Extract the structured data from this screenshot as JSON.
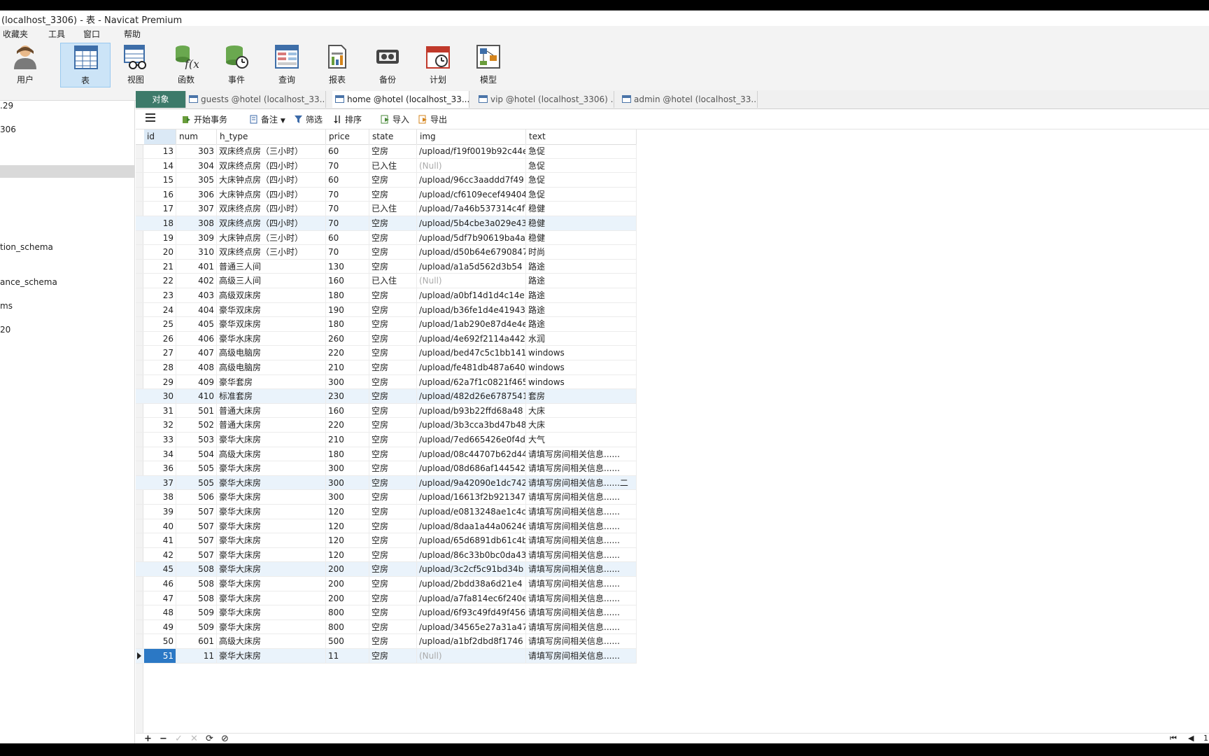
{
  "window_title": "(localhost_3306) - 表 - Navicat Premium",
  "menu": [
    "收藏夹",
    "工具",
    "窗口",
    "帮助"
  ],
  "toolbar": [
    {
      "label": "用户",
      "icon": "user-icon"
    },
    {
      "label": "表",
      "icon": "table-icon",
      "active": true
    },
    {
      "label": "视图",
      "icon": "view-icon"
    },
    {
      "label": "函数",
      "icon": "function-icon"
    },
    {
      "label": "事件",
      "icon": "event-icon"
    },
    {
      "label": "查询",
      "icon": "query-icon"
    },
    {
      "label": "报表",
      "icon": "report-icon"
    },
    {
      "label": "备份",
      "icon": "backup-icon"
    },
    {
      "label": "计划",
      "icon": "schedule-icon"
    },
    {
      "label": "模型",
      "icon": "model-icon"
    }
  ],
  "sidebar": [
    ".29",
    "306",
    "",
    "tion_schema",
    "ance_schema",
    "ms",
    "20"
  ],
  "tabs": [
    {
      "label": "对象",
      "type": "objects"
    },
    {
      "label": "guests @hotel (localhost_33...",
      "type": "table"
    },
    {
      "label": "home @hotel (localhost_33...",
      "type": "table",
      "active": true
    },
    {
      "label": "vip @hotel (localhost_3306) ...",
      "type": "table"
    },
    {
      "label": "admin @hotel (localhost_33...",
      "type": "table"
    }
  ],
  "subtoolbar": {
    "menu_icon": "hamburger-icon",
    "begin_transaction": "开始事务",
    "memo": "备注",
    "filter": "筛选",
    "sort": "排序",
    "import": "导入",
    "export": "导出"
  },
  "columns": [
    "id",
    "num",
    "h_type",
    "price",
    "state",
    "img",
    "text"
  ],
  "rows": [
    [
      "13",
      "303",
      "双床终点房（三小时）",
      "60",
      "空房",
      "/upload/f19f0019b92c44e",
      "急促"
    ],
    [
      "14",
      "304",
      "双床终点房（四小时）",
      "70",
      "已入住",
      "(Null)",
      "急促"
    ],
    [
      "15",
      "305",
      "大床钟点房（四小时）",
      "60",
      "空房",
      "/upload/96cc3aaddd7f49",
      "急促"
    ],
    [
      "16",
      "306",
      "大床钟点房（四小时）",
      "70",
      "空房",
      "/upload/cf6109ecef49404",
      "急促"
    ],
    [
      "17",
      "307",
      "双床终点房（四小时）",
      "70",
      "已入住",
      "/upload/7a46b537314c4fl",
      "稳健"
    ],
    [
      "18",
      "308",
      "双床终点房（四小时）",
      "70",
      "空房",
      "/upload/5b4cbe3a029e43",
      "稳健"
    ],
    [
      "19",
      "309",
      "大床钟点房（三小时）",
      "60",
      "空房",
      "/upload/5df7b90619ba4a",
      "稳健"
    ],
    [
      "20",
      "310",
      "双床终点房（三小时）",
      "70",
      "空房",
      "/upload/d50b64e6790847",
      "时尚"
    ],
    [
      "21",
      "401",
      "普通三人间",
      "130",
      "空房",
      "/upload/a1a5d562d3b54",
      "路途"
    ],
    [
      "22",
      "402",
      "高级三人间",
      "160",
      "已入住",
      "(Null)",
      "路途"
    ],
    [
      "23",
      "403",
      "高级双床房",
      "180",
      "空房",
      "/upload/a0bf14d1d4c14e",
      "路途"
    ],
    [
      "24",
      "404",
      "豪华双床房",
      "190",
      "空房",
      "/upload/b36fe1d4e41943",
      "路途"
    ],
    [
      "25",
      "405",
      "豪华双床房",
      "180",
      "空房",
      "/upload/1ab290e87d4e4e",
      "路途"
    ],
    [
      "26",
      "406",
      "豪华水床房",
      "260",
      "空房",
      "/upload/4e692f2114a442",
      "水润"
    ],
    [
      "27",
      "407",
      "高级电脑房",
      "220",
      "空房",
      "/upload/bed47c5c1bb141",
      "windows"
    ],
    [
      "28",
      "408",
      "高级电脑房",
      "210",
      "空房",
      "/upload/fe481db487a640",
      "windows"
    ],
    [
      "29",
      "409",
      "豪华套房",
      "300",
      "空房",
      "/upload/62a7f1c0821f465",
      "windows"
    ],
    [
      "30",
      "410",
      "标准套房",
      "230",
      "空房",
      "/upload/482d26e6787541",
      "套房"
    ],
    [
      "31",
      "501",
      "普通大床房",
      "160",
      "空房",
      "/upload/b93b22ffd68a48",
      "大床"
    ],
    [
      "32",
      "502",
      "普通大床房",
      "220",
      "空房",
      "/upload/3b3cca3bd47b48",
      "大床"
    ],
    [
      "33",
      "503",
      "豪华大床房",
      "210",
      "空房",
      "/upload/7ed665426e0f4d",
      "大气"
    ],
    [
      "34",
      "504",
      "高级大床房",
      "180",
      "空房",
      "/upload/08c44707b62d44",
      "请填写房间相关信息......"
    ],
    [
      "36",
      "505",
      "豪华大床房",
      "300",
      "空房",
      "/upload/08d686af144542",
      "请填写房间相关信息......"
    ],
    [
      "37",
      "505",
      "豪华大床房",
      "300",
      "空房",
      "/upload/9a42090e1dc742",
      "请填写房间相关信息......二"
    ],
    [
      "38",
      "506",
      "豪华大床房",
      "300",
      "空房",
      "/upload/16613f2b921347",
      "请填写房间相关信息......"
    ],
    [
      "39",
      "507",
      "豪华大床房",
      "120",
      "空房",
      "/upload/e0813248ae1c4c",
      "请填写房间相关信息......"
    ],
    [
      "40",
      "507",
      "豪华大床房",
      "120",
      "空房",
      "/upload/8daa1a44a06246",
      "请填写房间相关信息......"
    ],
    [
      "41",
      "507",
      "豪华大床房",
      "120",
      "空房",
      "/upload/65d6891db61c4b",
      "请填写房间相关信息......"
    ],
    [
      "42",
      "507",
      "豪华大床房",
      "120",
      "空房",
      "/upload/86c33b0bc0da43",
      "请填写房间相关信息......"
    ],
    [
      "45",
      "508",
      "豪华大床房",
      "200",
      "空房",
      "/upload/3c2cf5c91bd34b",
      "请填写房间相关信息......"
    ],
    [
      "46",
      "508",
      "豪华大床房",
      "200",
      "空房",
      "/upload/2bdd38a6d21e4",
      "请填写房间相关信息......"
    ],
    [
      "47",
      "508",
      "豪华大床房",
      "200",
      "空房",
      "/upload/a7fa814ec6f240e",
      "请填写房间相关信息......"
    ],
    [
      "48",
      "509",
      "豪华大床房",
      "800",
      "空房",
      "/upload/6f93c49fd49f456",
      "请填写房间相关信息......"
    ],
    [
      "49",
      "509",
      "豪华大床房",
      "800",
      "空房",
      "/upload/34565e27a31a47",
      "请填写房间相关信息......"
    ],
    [
      "50",
      "601",
      "高级大床房",
      "500",
      "空房",
      "/upload/a1bf2dbd8f1746",
      "请填写房间相关信息......"
    ],
    [
      "51",
      "11",
      "豪华大床房",
      "11",
      "空房",
      "(Null)",
      "请填写房间相关信息......"
    ]
  ],
  "status": {
    "add": "+",
    "delete": "−",
    "apply": "✓",
    "cancel": "✕",
    "refresh": "⟳",
    "stop": "⊘",
    "first": "⏮",
    "prev": "◀",
    "page": "1"
  }
}
